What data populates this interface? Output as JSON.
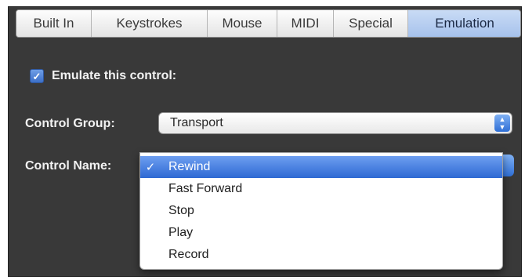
{
  "tabs": [
    {
      "label": "Built In"
    },
    {
      "label": "Keystrokes"
    },
    {
      "label": "Mouse"
    },
    {
      "label": "MIDI"
    },
    {
      "label": "Special"
    },
    {
      "label": "Emulation",
      "selected": true
    }
  ],
  "emulate": {
    "label": "Emulate this control:",
    "checked": true
  },
  "control_group": {
    "label": "Control Group:",
    "value": "Transport"
  },
  "control_name": {
    "label": "Control Name:",
    "options": [
      "Rewind",
      "Fast Forward",
      "Stop",
      "Play",
      "Record"
    ],
    "selected": "Rewind",
    "checkmark": "✓"
  },
  "colors": {
    "panel_bg": "#393939",
    "selection": "#2e69d3",
    "checkbox": "#3c6fc7"
  }
}
